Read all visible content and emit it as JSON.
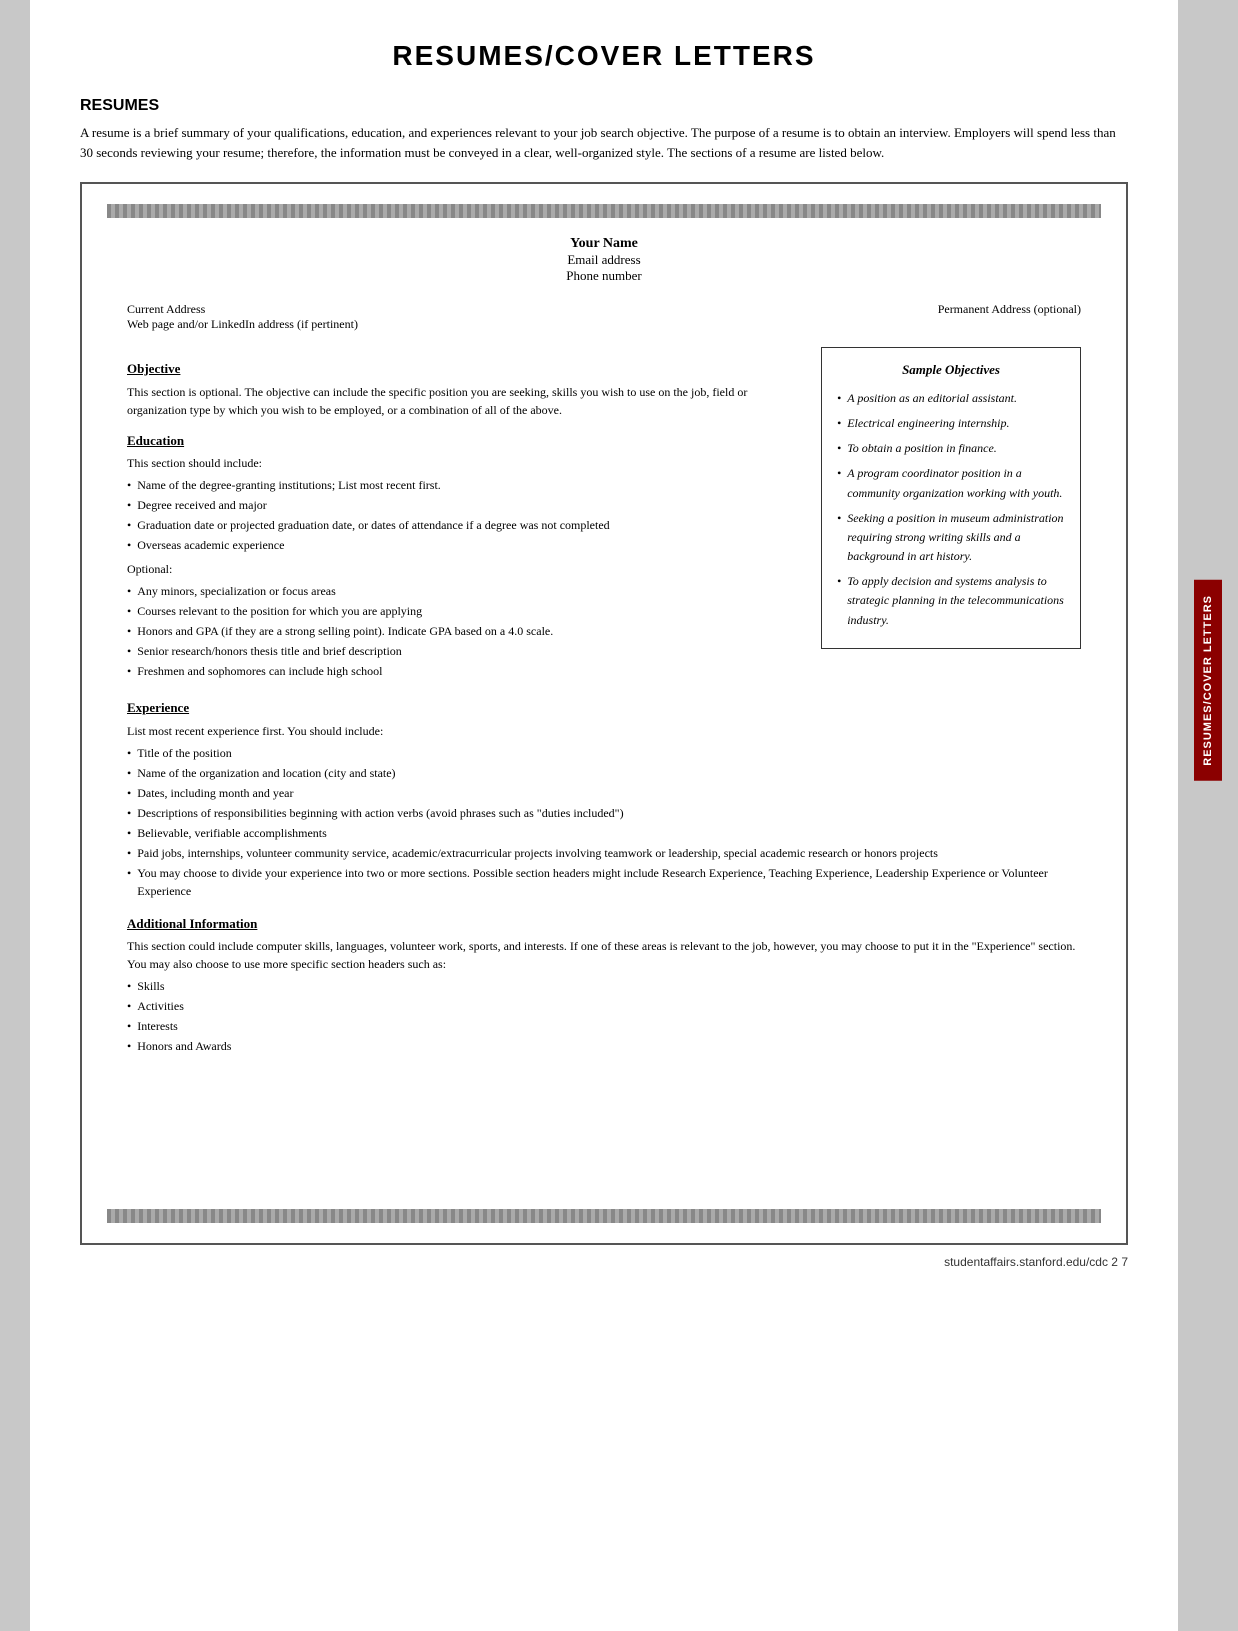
{
  "page": {
    "title": "RESUMES/COVER LETTERS",
    "sidebar_label": "RESUMES/COVER LETTERS",
    "footer": "studentaffairs.stanford.edu/cdc     2  7"
  },
  "resumes_section": {
    "heading": "RESUMES",
    "intro": "A resume is a brief summary of your qualifications, education, and experiences relevant to your job search objective. The purpose of a resume is to obtain an interview. Employers will spend less than 30 seconds reviewing your resume; therefore, the information must be conveyed in a clear, well-organized style. The sections of a resume are listed below."
  },
  "resume_template": {
    "name": "Your Name",
    "email": "Email address",
    "phone": "Phone number",
    "current_address_label": "Current Address",
    "current_address_sub": "Web page and/or LinkedIn address (if pertinent)",
    "permanent_address_label": "Permanent Address (optional)",
    "objective_title": "Objective",
    "objective_text": "This section is optional. The objective can include the specific position you are seeking, skills you wish to use on the job, field or organization type by which you wish to be employed, or a combination of all of the above.",
    "education_title": "Education",
    "education_intro": "This section should include:",
    "education_bullets": [
      "Name of the degree-granting institutions; List most recent first.",
      "Degree received and major",
      "Graduation date or projected graduation date, or dates of attendance if a degree was not completed",
      "Overseas academic experience"
    ],
    "education_optional_label": "Optional:",
    "education_optional_bullets": [
      "Any minors, specialization or focus areas",
      "Courses relevant to the position for which you are applying",
      "Honors and GPA (if they are a strong selling point). Indicate GPA based on a 4.0 scale.",
      "Senior research/honors thesis title and brief description",
      "Freshmen and sophomores can include high school"
    ],
    "experience_title": "Experience",
    "experience_intro": "List most recent experience first. You should include:",
    "experience_bullets": [
      "Title of the position",
      "Name of the organization and location (city and state)",
      "Dates, including month and year",
      "Descriptions of responsibilities beginning with action verbs (avoid phrases such as \"duties included\")",
      "Believable, verifiable accomplishments",
      "Paid jobs, internships, volunteer community service, academic/extracurricular projects involving teamwork or leadership, special academic research or honors projects",
      "You may choose to divide your experience into two or more sections. Possible section headers might include Research Experience, Teaching Experience, Leadership Experience or Volunteer Experience"
    ],
    "additional_title": "Additional Information",
    "additional_text": "This section could include computer skills, languages, volunteer work, sports, and interests. If one of these areas is relevant to the job, however, you may choose to put it in the \"Experience\" section. You may also choose to use more specific section headers such as:",
    "additional_bullets": [
      "Skills",
      "Activities",
      "Interests",
      "Honors and Awards"
    ]
  },
  "sample_objectives": {
    "title": "Sample Objectives",
    "items": [
      "A position as an editorial assistant.",
      "Electrical engineering internship.",
      "To obtain a position in finance.",
      "A program coordinator position in a community organization working with youth.",
      "Seeking a position in museum administration requiring strong writing skills and a background in art history.",
      "To apply decision and systems analysis to strategic planning in the telecommunications industry."
    ]
  }
}
